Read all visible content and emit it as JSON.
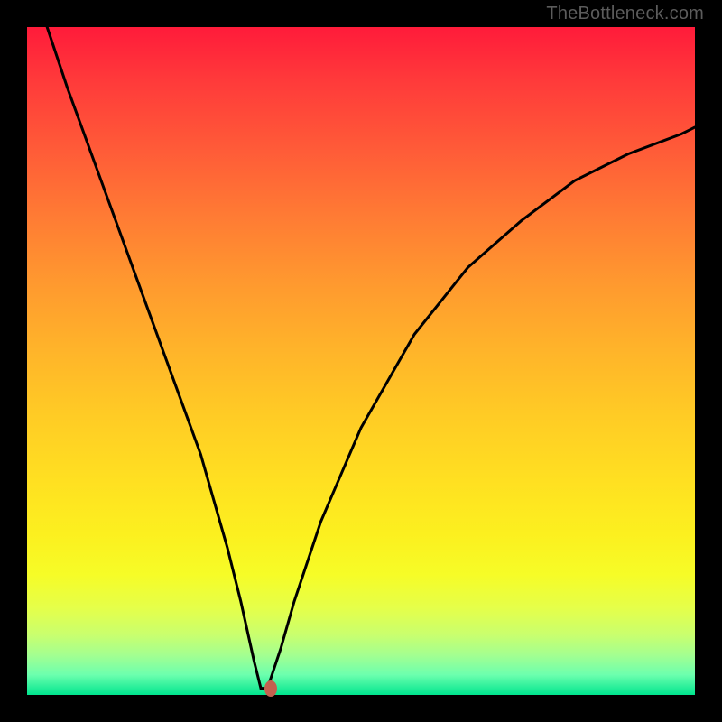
{
  "watermark": "TheBottleneck.com",
  "chart_data": {
    "type": "line",
    "title": "",
    "xlabel": "",
    "ylabel": "",
    "xlim": [
      0,
      100
    ],
    "ylim": [
      0,
      100
    ],
    "grid": false,
    "legend": false,
    "background_gradient": {
      "top": "#ff1b3a",
      "mid": "#ffe021",
      "bottom": "#00e58e"
    },
    "series": [
      {
        "name": "curve",
        "color": "#000000",
        "x": [
          3,
          6,
          10,
          14,
          18,
          22,
          26,
          30,
          32,
          34,
          35,
          36,
          38,
          40,
          44,
          50,
          58,
          66,
          74,
          82,
          90,
          98,
          100
        ],
        "values": [
          100,
          91,
          80,
          69,
          58,
          47,
          36,
          22,
          14,
          5,
          1,
          1,
          7,
          14,
          26,
          40,
          54,
          64,
          71,
          77,
          81,
          84,
          85
        ]
      }
    ],
    "marker": {
      "x": 36.5,
      "y": 1,
      "color": "#c4604f"
    }
  }
}
